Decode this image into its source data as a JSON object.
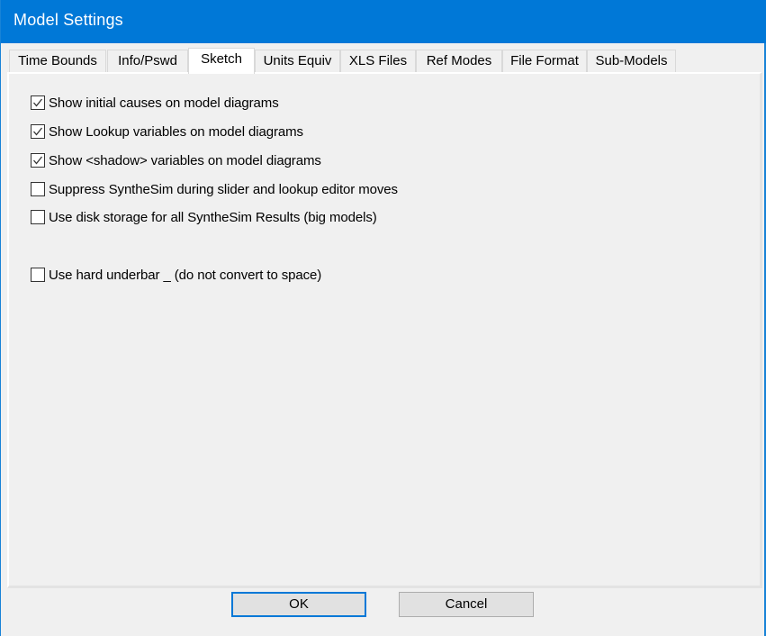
{
  "window": {
    "title": "Model Settings",
    "accent_color": "#0078d7"
  },
  "tabs": [
    {
      "label": "Time Bounds",
      "active": false
    },
    {
      "label": "Info/Pswd",
      "active": false
    },
    {
      "label": "Sketch",
      "active": true
    },
    {
      "label": "Units Equiv",
      "active": false
    },
    {
      "label": "XLS Files",
      "active": false
    },
    {
      "label": "Ref Modes",
      "active": false
    },
    {
      "label": "File Format",
      "active": false
    },
    {
      "label": "Sub-Models",
      "active": false
    }
  ],
  "options": [
    {
      "label": "Show initial causes on model diagrams",
      "checked": true
    },
    {
      "label": "Show Lookup variables on model diagrams",
      "checked": true
    },
    {
      "label": "Show <shadow> variables on model diagrams",
      "checked": true
    },
    {
      "label": "Suppress SyntheSim during slider and lookup editor moves",
      "checked": false
    },
    {
      "label": "Use disk storage for all SyntheSim Results (big models)",
      "checked": false
    },
    {
      "label": "Use hard underbar _ (do not convert to space)",
      "checked": false
    }
  ],
  "buttons": {
    "ok": "OK",
    "cancel": "Cancel"
  }
}
